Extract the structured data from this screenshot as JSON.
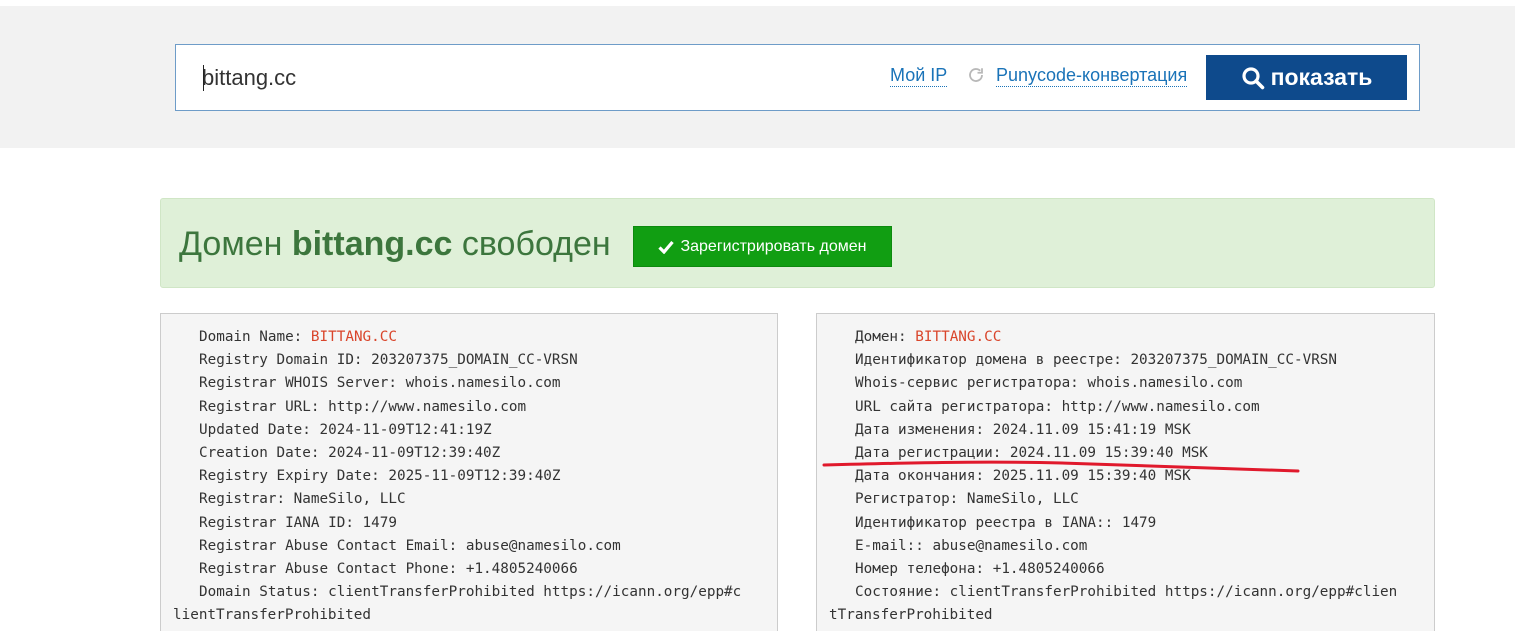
{
  "search": {
    "value": "bittang.cc",
    "my_ip_label": "Мой IP",
    "punycode_label": "Punycode-конвертация",
    "submit_label": "показать"
  },
  "result": {
    "title_prefix": "Домен",
    "domain": "bittang.cc",
    "title_suffix": "свободен",
    "register_label": "Зарегистрировать домен"
  },
  "whois_en": [
    {
      "label": "Domain Name: ",
      "value": "BITTANG.CC"
    },
    {
      "label": "Registry Domain ID: 203207375_DOMAIN_CC-VRSN"
    },
    {
      "label": "Registrar WHOIS Server: whois.namesilo.com"
    },
    {
      "label": "Registrar URL: http://www.namesilo.com"
    },
    {
      "label": "Updated Date: 2024-11-09T12:41:19Z"
    },
    {
      "label": "Creation Date: 2024-11-09T12:39:40Z"
    },
    {
      "label": "Registry Expiry Date: 2025-11-09T12:39:40Z"
    },
    {
      "label": "Registrar: NameSilo, LLC"
    },
    {
      "label": "Registrar IANA ID: 1479"
    },
    {
      "label": "Registrar Abuse Contact Email: abuse@namesilo.com"
    },
    {
      "label": "Registrar Abuse Contact Phone: +1.4805240066"
    },
    {
      "label": "Domain Status: clientTransferProhibited https://icann.org/epp#c"
    },
    {
      "label": "lientTransferProhibited"
    }
  ],
  "whois_ru": [
    {
      "label": "Домен: ",
      "value": "BITTANG.CC"
    },
    {
      "label": "Идентификатор домена в реестре: 203207375_DOMAIN_CC-VRSN"
    },
    {
      "label": "Whois-сервис регистратора: whois.namesilo.com"
    },
    {
      "label": "URL сайта регистратора: http://www.namesilo.com"
    },
    {
      "label": "Дата изменения: 2024.11.09 15:41:19 MSK"
    },
    {
      "label": "Дата регистрации: 2024.11.09 15:39:40 MSK"
    },
    {
      "label": "Дата окончания: 2025.11.09 15:39:40 MSK"
    },
    {
      "label": "Регистратор: NameSilo, LLC"
    },
    {
      "label": "Идентификатор реестра в IANA:: 1479"
    },
    {
      "label": "E-mail:: abuse@namesilo.com"
    },
    {
      "label": "Номер телефона: +1.4805240066"
    },
    {
      "label": "Состояние: clientTransferProhibited https://icann.org/epp#clien"
    },
    {
      "label": "tTransferProhibited"
    }
  ],
  "colors": {
    "primary_button": "#0e4a8c",
    "success_button": "#119e12",
    "alert_background": "#dff0d8",
    "alert_text": "#3c763d",
    "link": "#1a73b8",
    "highlight": "#d9452b",
    "annotation": "#e0192c"
  },
  "icons": [
    "search-icon",
    "refresh-icon",
    "checkmark-icon"
  ]
}
